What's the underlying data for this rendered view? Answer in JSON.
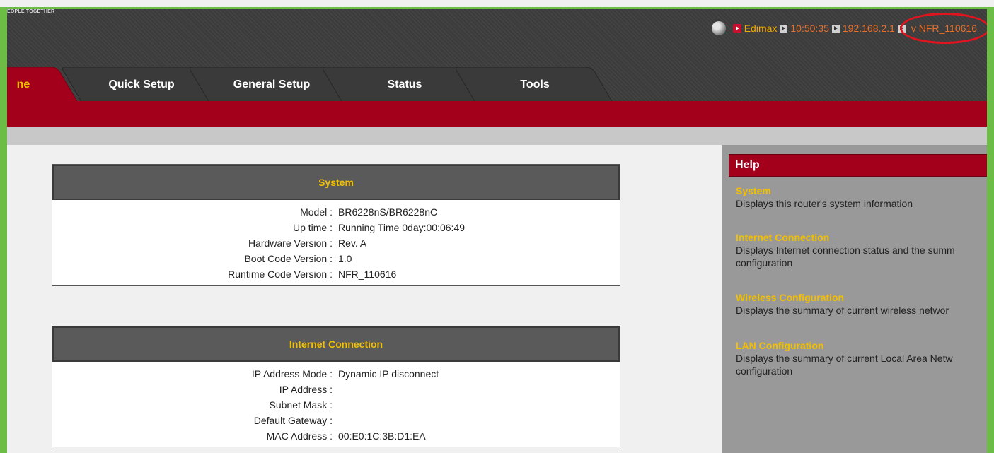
{
  "header": {
    "tagline": "EOPLE TOGETHER",
    "brand": "Edimax",
    "time": "10:50:35",
    "ip": "192.168.2.1",
    "version": "v NFR_110616"
  },
  "tabs": [
    {
      "label": "ne",
      "active": true
    },
    {
      "label": "Quick Setup",
      "active": false
    },
    {
      "label": "General Setup",
      "active": false
    },
    {
      "label": "Status",
      "active": false
    },
    {
      "label": "Tools",
      "active": false
    }
  ],
  "system": {
    "title": "System",
    "rows": [
      {
        "label": "Model :",
        "value": "BR6228nS/BR6228nC"
      },
      {
        "label": "Up time :",
        "value": "Running Time 0day:00:06:49"
      },
      {
        "label": "Hardware Version :",
        "value": "Rev. A"
      },
      {
        "label": "Boot Code Version :",
        "value": "1.0"
      },
      {
        "label": "Runtime Code Version :",
        "value": "NFR_110616"
      }
    ]
  },
  "internet": {
    "title": "Internet Connection",
    "rows": [
      {
        "label": "IP Address Mode :",
        "value": "Dynamic IP disconnect"
      },
      {
        "label": "IP Address :",
        "value": ""
      },
      {
        "label": "Subnet Mask :",
        "value": ""
      },
      {
        "label": "Default Gateway :",
        "value": ""
      },
      {
        "label": "MAC Address :",
        "value": "00:E0:1C:3B:D1:EA"
      }
    ]
  },
  "help": {
    "title": "Help",
    "items": [
      {
        "title": "System",
        "lines": [
          "Displays this router's system information"
        ]
      },
      {
        "title": "Internet Connection",
        "lines": [
          "Displays Internet connection status and the summ",
          "configuration"
        ]
      },
      {
        "title": "Wireless Configuration",
        "lines": [
          "Displays the summary of current wireless networ"
        ]
      },
      {
        "title": "LAN Configuration",
        "lines": [
          "Displays the summary of current Local Area Netw",
          "configuration"
        ]
      }
    ]
  },
  "colors": {
    "frame": "#6cbd45",
    "accent_red": "#a3001b",
    "label_yellow": "#f3c000",
    "header_dark": "#3c3c3c",
    "help_bg": "#999999"
  }
}
